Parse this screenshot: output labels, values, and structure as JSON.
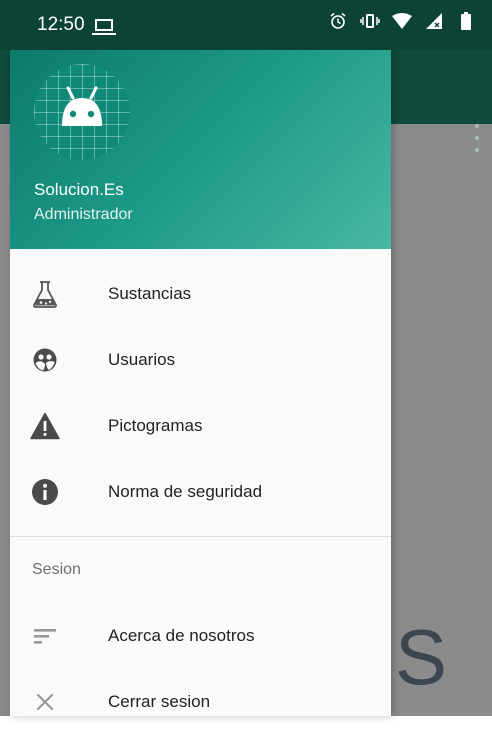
{
  "statusbar": {
    "time": "12:50"
  },
  "profile": {
    "name": "Solucion.Es",
    "role": "Administrador"
  },
  "menu": {
    "items": [
      {
        "label": "Sustancias",
        "icon": "flask-icon"
      },
      {
        "label": "Usuarios",
        "icon": "users-icon"
      },
      {
        "label": "Pictogramas",
        "icon": "warning-icon"
      },
      {
        "label": "Norma de seguridad",
        "icon": "info-icon"
      }
    ],
    "section_title": "Sesion",
    "session_items": [
      {
        "label": "Acerca de nosotros",
        "icon": "sort-lines-icon"
      },
      {
        "label": "Cerrar sesion",
        "icon": "close-icon"
      }
    ]
  },
  "background": {
    "partial_text": "S"
  },
  "colors": {
    "statusbar": "#0d4337",
    "header_start": "#0c7a6c",
    "header_end": "#48b8a4",
    "scrim": "#8b8b8b"
  }
}
